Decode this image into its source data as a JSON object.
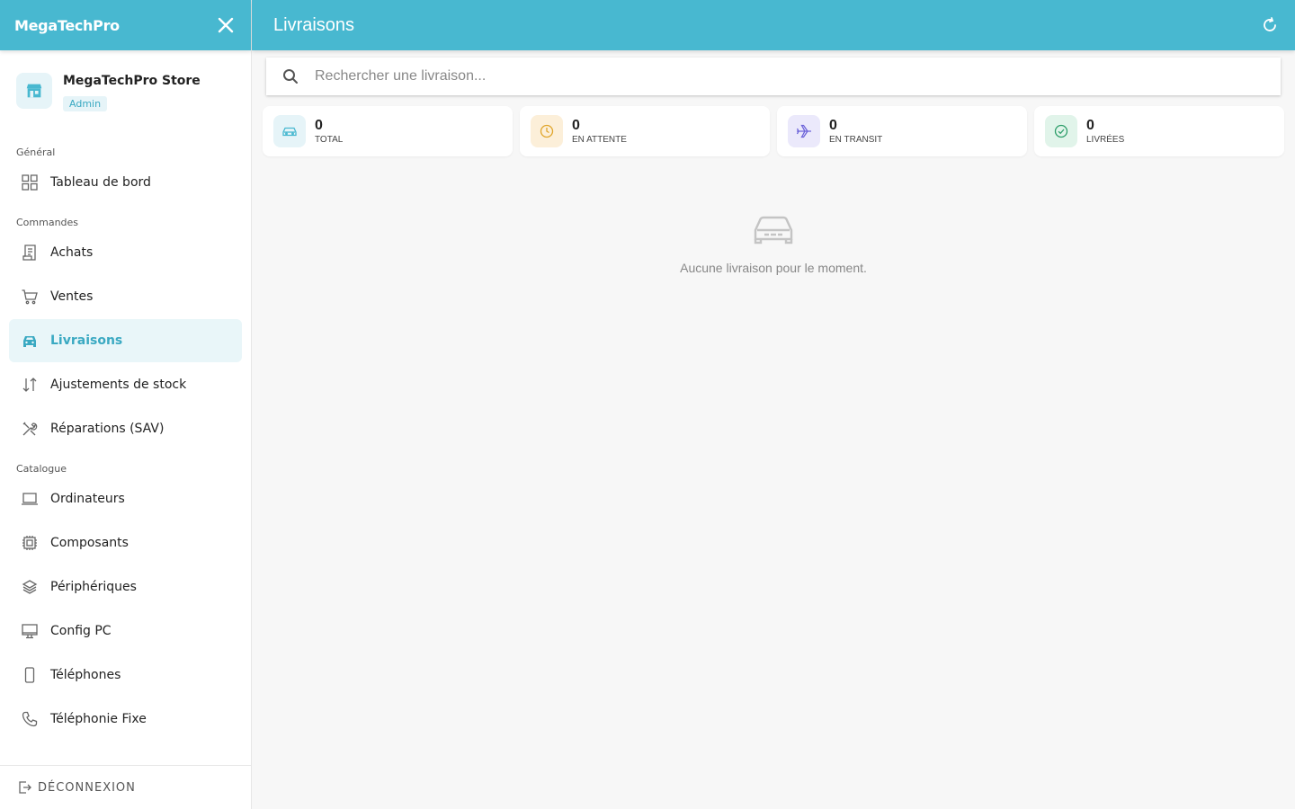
{
  "app": {
    "brand": "MegaTechPro"
  },
  "store": {
    "name": "MegaTechPro Store",
    "role": "Admin"
  },
  "sidebar": {
    "sections": [
      {
        "label": "Général"
      },
      {
        "label": "Commandes"
      },
      {
        "label": "Catalogue"
      }
    ],
    "items": [
      {
        "label": "Tableau de bord",
        "icon": "dashboard-icon"
      },
      {
        "label": "Achats",
        "icon": "receipt-icon"
      },
      {
        "label": "Ventes",
        "icon": "cart-icon"
      },
      {
        "label": "Livraisons",
        "icon": "car-icon",
        "active": true
      },
      {
        "label": "Ajustements de stock",
        "icon": "arrows-updown-icon"
      },
      {
        "label": "Réparations (SAV)",
        "icon": "tools-icon"
      },
      {
        "label": "Ordinateurs",
        "icon": "laptop-icon"
      },
      {
        "label": "Composants",
        "icon": "chip-icon"
      },
      {
        "label": "Périphériques",
        "icon": "layers-icon"
      },
      {
        "label": "Config PC",
        "icon": "monitor-icon"
      },
      {
        "label": "Téléphones",
        "icon": "phone-icon"
      },
      {
        "label": "Téléphonie Fixe",
        "icon": "landline-icon"
      }
    ],
    "logout": "DÉCONNEXION"
  },
  "header": {
    "title": "Livraisons"
  },
  "search": {
    "placeholder": "Rechercher une livraison..."
  },
  "stats": [
    {
      "value": "0",
      "label": "TOTAL",
      "color": "#48b8d0",
      "bg": "#e6f4f8"
    },
    {
      "value": "0",
      "label": "EN ATTENTE",
      "color": "#e0a52a",
      "bg": "#fcefd9"
    },
    {
      "value": "0",
      "label": "EN TRANSIT",
      "color": "#6c63d9",
      "bg": "#ebe9fb"
    },
    {
      "value": "0",
      "label": "LIVRÉES",
      "color": "#2e9e6a",
      "bg": "#e1f4ea"
    }
  ],
  "empty": {
    "message": "Aucune livraison pour le moment."
  },
  "colors": {
    "primary": "#48b8d0",
    "active_bg": "#e9f6f9",
    "active_text": "#3aa9c2"
  }
}
